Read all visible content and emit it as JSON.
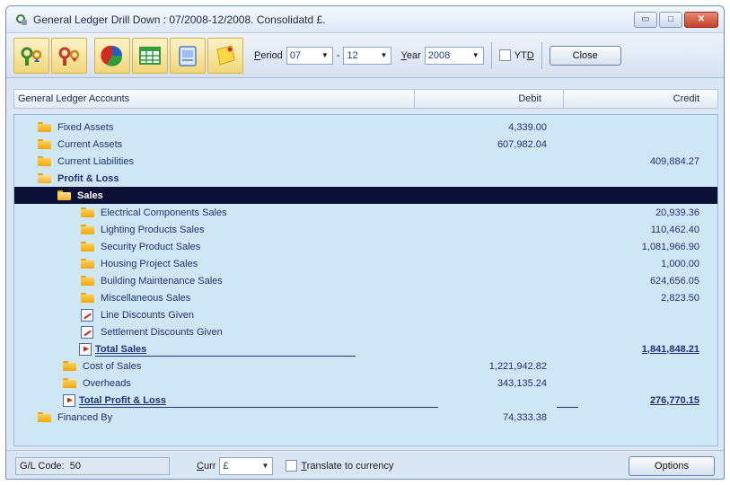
{
  "window": {
    "title": "General Ledger Drill Down : 07/2008-12/2008. Consolidatd £.",
    "minimize_glyph": "▭",
    "maximize_glyph": "□",
    "close_glyph": "✕"
  },
  "toolbar": {
    "icons": [
      "filter-up-icon",
      "filter-down-icon",
      "pie-chart-icon",
      "spreadsheet-icon",
      "report-icon",
      "notes-icon"
    ],
    "period_label_prefix": "P",
    "period_label_rest": "eriod",
    "period_from": "07",
    "period_to": "12",
    "year_label_prefix": "Y",
    "year_label_rest": "ear",
    "year": "2008",
    "ytd_label_main": "YT",
    "ytd_label_underlined": "D",
    "close_label": "Close",
    "dropdown_glyph": "▼",
    "dash": "-"
  },
  "columns": {
    "accounts": "General Ledger Accounts",
    "debit": "Debit",
    "credit": "Credit"
  },
  "rows": [
    {
      "name": "Fixed Assets",
      "debit": "4,339.00",
      "credit": ""
    },
    {
      "name": "Current Assets",
      "debit": "607,982.04",
      "credit": ""
    },
    {
      "name": "Current Liabilities",
      "debit": "",
      "credit": "409,884.27"
    },
    {
      "name": "Profit & Loss",
      "debit": "",
      "credit": ""
    },
    {
      "name": "Sales",
      "debit": "",
      "credit": ""
    },
    {
      "name": "Electrical Components Sales",
      "debit": "",
      "credit": "20,939.36"
    },
    {
      "name": "Lighting Products Sales",
      "debit": "",
      "credit": "110,462.40"
    },
    {
      "name": "Security Product Sales",
      "debit": "",
      "credit": "1,081,966.90"
    },
    {
      "name": "Housing Project Sales",
      "debit": "",
      "credit": "1,000.00"
    },
    {
      "name": "Building Maintenance Sales",
      "debit": "",
      "credit": "624,656.05"
    },
    {
      "name": "Miscellaneous Sales",
      "debit": "",
      "credit": "2,823.50"
    },
    {
      "name": "Line Discounts Given",
      "debit": "",
      "credit": ""
    },
    {
      "name": "Settlement Discounts Given",
      "debit": "",
      "credit": ""
    },
    {
      "name": "Total  Sales",
      "debit": "",
      "credit": "1,841,848.21"
    },
    {
      "name": "Cost of Sales",
      "debit": "1,221,942.82",
      "credit": ""
    },
    {
      "name": "Overheads",
      "debit": "343,135.24",
      "credit": ""
    },
    {
      "name": "Total  Profit & Loss",
      "debit": "",
      "credit": "276,770.15"
    },
    {
      "name": "Financed By",
      "debit": "74,333.38",
      "credit": ""
    }
  ],
  "status": {
    "gl_code_label": "G/L Code:",
    "gl_code_value": "50",
    "curr_label_prefix": "C",
    "curr_label_rest": "urr",
    "curr_value": "£",
    "translate_prefix": "T",
    "translate_rest": "ranslate to currency",
    "options_label": "Options"
  }
}
